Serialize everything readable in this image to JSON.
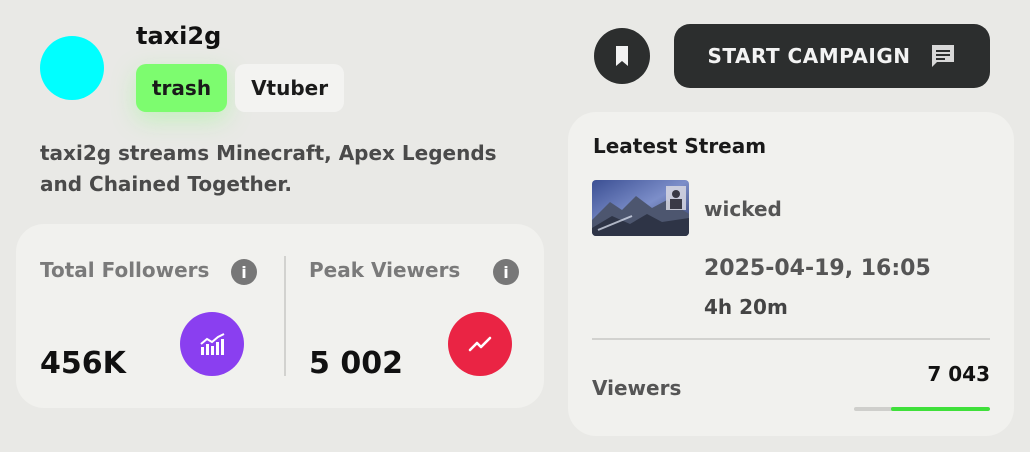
{
  "profile": {
    "username": "taxi2g",
    "avatar_color": "#00ffff",
    "tags": [
      {
        "label": "trash",
        "color": "#7dfc6f"
      },
      {
        "label": "Vtuber",
        "color": "#f3f3f1"
      }
    ],
    "bio": "taxi2g streams Minecraft, Apex Legends and Chained Together."
  },
  "stats": {
    "followers": {
      "label": "Total Followers",
      "value": "456K",
      "badge_color": "#8a3ff0",
      "icon": "chart-bars-icon"
    },
    "peak_viewers": {
      "label": "Peak Viewers",
      "value": "5 002",
      "badge_color": "#ea2444",
      "icon": "trend-up-icon"
    }
  },
  "actions": {
    "bookmark_icon": "bookmark-icon",
    "campaign_label": "START CAMPAIGN",
    "campaign_icon": "message-icon"
  },
  "latest_stream": {
    "title": "Leatest Stream",
    "name": "wicked",
    "date": "2025-04-19, 16:05",
    "duration": "4h 20m",
    "viewers_label": "Viewers",
    "viewers_value": "7 043",
    "viewers_fraction": 0.73,
    "accent_color": "#3fe03a"
  }
}
